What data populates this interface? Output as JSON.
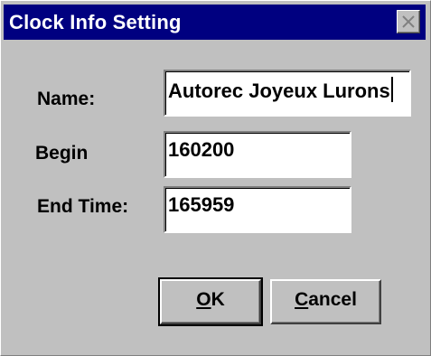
{
  "window": {
    "title": "Clock Info Setting"
  },
  "fields": {
    "name": {
      "label": "Name:",
      "value": "Autorec Joyeux Lurons"
    },
    "begin": {
      "label": "Begin",
      "value": "160200"
    },
    "end_time": {
      "label": "End Time:",
      "value": "165959"
    }
  },
  "buttons": {
    "ok": {
      "mnemonic": "O",
      "rest": "K"
    },
    "cancel": {
      "mnemonic": "C",
      "rest": "ancel"
    }
  },
  "icons": {
    "close": "close-icon"
  },
  "colors": {
    "titlebar": "#000080",
    "face": "#c0c0c0"
  }
}
